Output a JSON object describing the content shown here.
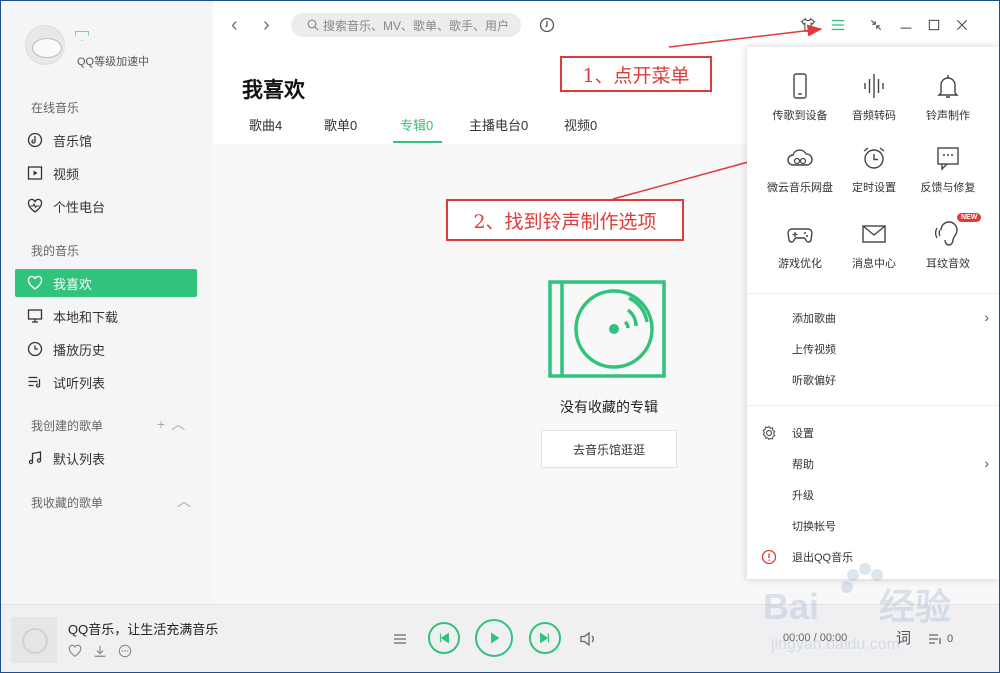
{
  "profile": {
    "status": "QQ等级加速中"
  },
  "sidebar": {
    "online_title": "在线音乐",
    "online": [
      {
        "label": "音乐馆"
      },
      {
        "label": "视频"
      },
      {
        "label": "个性电台"
      }
    ],
    "my_title": "我的音乐",
    "mine": [
      {
        "label": "我喜欢"
      },
      {
        "label": "本地和下载"
      },
      {
        "label": "播放历史"
      },
      {
        "label": "试听列表"
      }
    ],
    "created_title": "我创建的歌单",
    "created": [
      {
        "label": "默认列表"
      }
    ],
    "collected_title": "我收藏的歌单"
  },
  "header": {
    "search_placeholder": "搜索音乐、MV、歌单、歌手、用户"
  },
  "main": {
    "title": "我喜欢",
    "tabs": [
      {
        "label": "歌曲4"
      },
      {
        "label": "歌单0"
      },
      {
        "label": "专辑0"
      },
      {
        "label": "主播电台0"
      },
      {
        "label": "视频0"
      }
    ],
    "empty_text": "没有收藏的专辑",
    "empty_button": "去音乐馆逛逛"
  },
  "annotations": {
    "step1": "1、点开菜单",
    "step2": "2、找到铃声制作选项"
  },
  "menu": {
    "grid": [
      {
        "label": "传歌到设备",
        "icon": "phone-icon"
      },
      {
        "label": "音频转码",
        "icon": "waveform-icon"
      },
      {
        "label": "铃声制作",
        "icon": "bell-icon"
      },
      {
        "label": "微云音乐网盘",
        "icon": "cloud-icon"
      },
      {
        "label": "定时设置",
        "icon": "alarm-clock-icon"
      },
      {
        "label": "反馈与修复",
        "icon": "feedback-icon"
      },
      {
        "label": "游戏优化",
        "icon": "gamepad-icon"
      },
      {
        "label": "消息中心",
        "icon": "envelope-icon"
      },
      {
        "label": "耳纹音效",
        "icon": "ear-icon"
      }
    ],
    "new_badge": "NEW",
    "group1": [
      {
        "label": "添加歌曲"
      },
      {
        "label": "上传视频"
      },
      {
        "label": "听歌偏好"
      }
    ],
    "group2": [
      {
        "label": "设置"
      },
      {
        "label": "帮助"
      },
      {
        "label": "升级"
      },
      {
        "label": "切换帐号"
      },
      {
        "label": "退出QQ音乐"
      }
    ]
  },
  "player": {
    "song": "QQ音乐，让生活充满音乐",
    "time": "00:00 / 00:00",
    "lyric_label": "词",
    "playlist_count": "0"
  },
  "colors": {
    "accent": "#31c27c",
    "annotation": "#e03a3a"
  }
}
